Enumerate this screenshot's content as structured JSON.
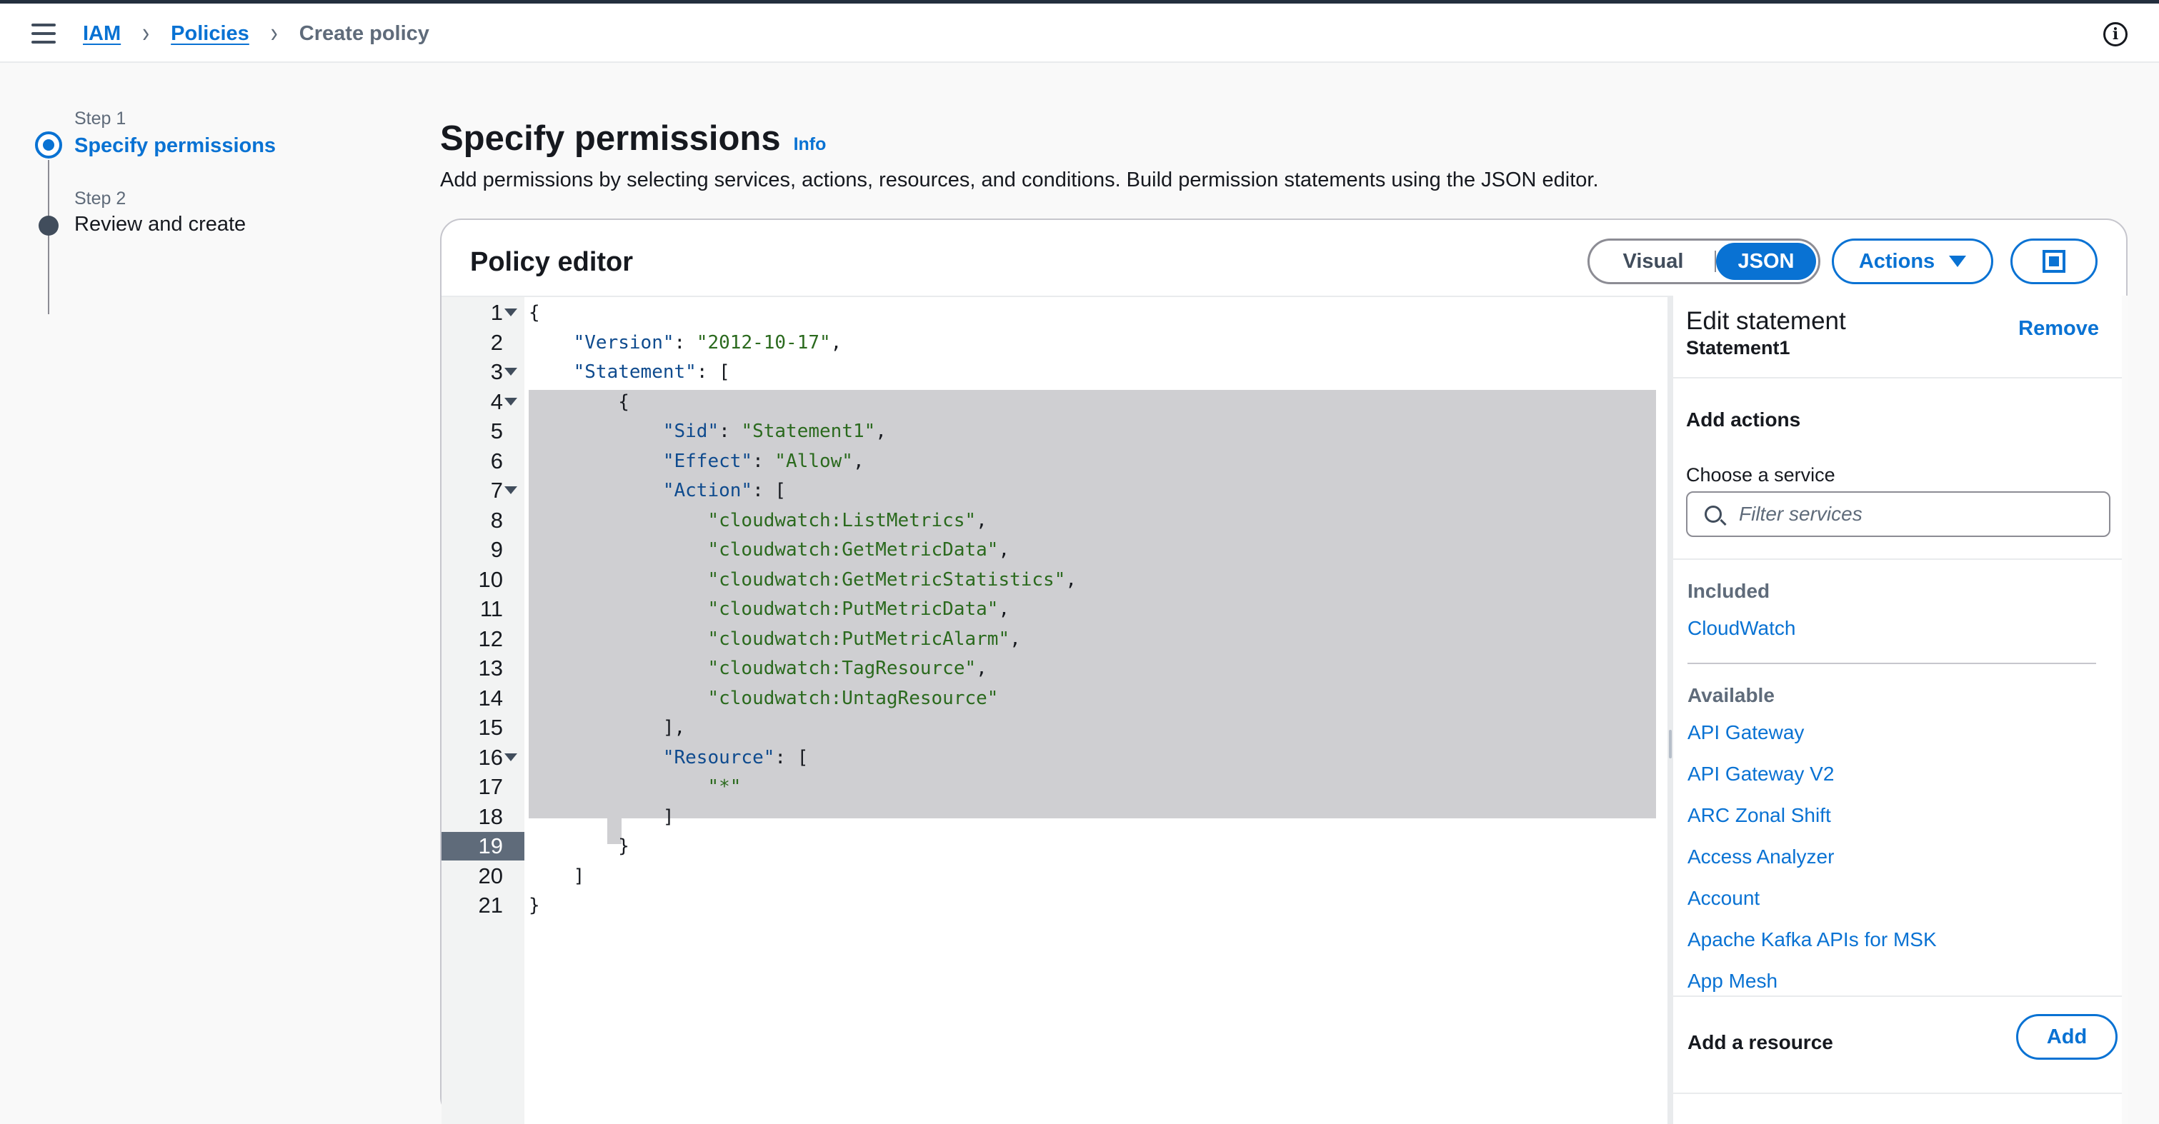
{
  "breadcrumb": {
    "items": [
      "IAM",
      "Policies"
    ],
    "current": "Create policy"
  },
  "steps": [
    {
      "label": "Step 1",
      "title": "Specify permissions"
    },
    {
      "label": "Step 2",
      "title": "Review and create"
    }
  ],
  "page": {
    "title": "Specify permissions",
    "info_link": "Info",
    "description": "Add permissions by selecting services, actions, resources, and conditions. Build permission statements using the JSON editor."
  },
  "editor": {
    "title": "Policy editor",
    "toggle": {
      "visual": "Visual",
      "json": "JSON",
      "selected": "JSON"
    },
    "actions_label": "Actions",
    "active_line": 19,
    "lines": [
      {
        "n": "1",
        "text": "{"
      },
      {
        "n": "2",
        "text": "    \"Version\": \"2012-10-17\","
      },
      {
        "n": "3",
        "text": "    \"Statement\": ["
      },
      {
        "n": "4",
        "text": "        {"
      },
      {
        "n": "5",
        "text": "            \"Sid\": \"Statement1\","
      },
      {
        "n": "6",
        "text": "            \"Effect\": \"Allow\","
      },
      {
        "n": "7",
        "text": "            \"Action\": ["
      },
      {
        "n": "8",
        "text": "                \"cloudwatch:ListMetrics\","
      },
      {
        "n": "9",
        "text": "                \"cloudwatch:GetMetricData\","
      },
      {
        "n": "10",
        "text": "                \"cloudwatch:GetMetricStatistics\","
      },
      {
        "n": "11",
        "text": "                \"cloudwatch:PutMetricData\","
      },
      {
        "n": "12",
        "text": "                \"cloudwatch:PutMetricAlarm\","
      },
      {
        "n": "13",
        "text": "                \"cloudwatch:TagResource\","
      },
      {
        "n": "14",
        "text": "                \"cloudwatch:UntagResource\""
      },
      {
        "n": "15",
        "text": "            ],"
      },
      {
        "n": "16",
        "text": "            \"Resource\": ["
      },
      {
        "n": "17",
        "text": "                \"*\""
      },
      {
        "n": "18",
        "text": "            ]"
      },
      {
        "n": "19",
        "text": "        }"
      },
      {
        "n": "20",
        "text": "    ]"
      },
      {
        "n": "21",
        "text": "}"
      }
    ]
  },
  "side_panel": {
    "title": "Edit statement",
    "statement": "Statement1",
    "remove_label": "Remove",
    "add_actions": "Add actions",
    "choose_service": "Choose a service",
    "filter_placeholder": "Filter services",
    "included_heading": "Included",
    "included": [
      "CloudWatch"
    ],
    "available_heading": "Available",
    "available": [
      "API Gateway",
      "API Gateway V2",
      "ARC Zonal Shift",
      "Access Analyzer",
      "Account",
      "Apache Kafka APIs for MSK",
      "App Mesh"
    ],
    "add_resource": "Add a resource",
    "add_label": "Add"
  },
  "colors": {
    "accent": "#0972d3",
    "selection": "#cfcfd2",
    "header_dark": "#232f3e"
  }
}
